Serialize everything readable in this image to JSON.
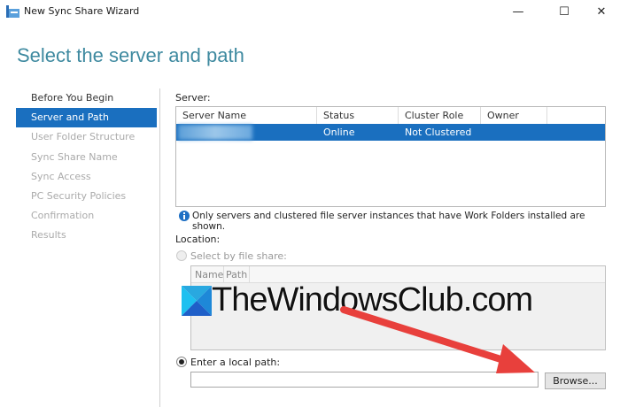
{
  "window": {
    "title": "New Sync Share Wizard",
    "minimize": "—",
    "maximize": "☐",
    "close": "✕"
  },
  "heading": "Select the server and path",
  "nav": [
    {
      "label": "Before You Begin",
      "state": "done"
    },
    {
      "label": "Server and Path",
      "state": "selected"
    },
    {
      "label": "User Folder Structure",
      "state": "disabled"
    },
    {
      "label": "Sync Share Name",
      "state": "disabled"
    },
    {
      "label": "Sync Access",
      "state": "disabled"
    },
    {
      "label": "PC Security Policies",
      "state": "disabled"
    },
    {
      "label": "Confirmation",
      "state": "disabled"
    },
    {
      "label": "Results",
      "state": "disabled"
    }
  ],
  "server": {
    "label": "Server:",
    "columns": [
      "Server Name",
      "Status",
      "Cluster Role",
      "Owner Node"
    ],
    "rows": [
      {
        "name": "",
        "status": "Online",
        "cluster_role": "Not Clustered",
        "owner_node": ""
      }
    ]
  },
  "info": "Only servers and clustered file server instances that have Work Folders installed are shown.",
  "location": {
    "label": "Location:",
    "file_share_option": "Select by file share:",
    "file_share_columns": [
      "Name",
      "Path"
    ],
    "local_path_option": "Enter a local path:",
    "local_path_value": "",
    "browse": "Browse..."
  },
  "watermark": "TheWindowsClub.com",
  "colors": {
    "accent": "#1a6fbf",
    "heading": "#3f8aa0",
    "arrow": "#e8403c"
  }
}
